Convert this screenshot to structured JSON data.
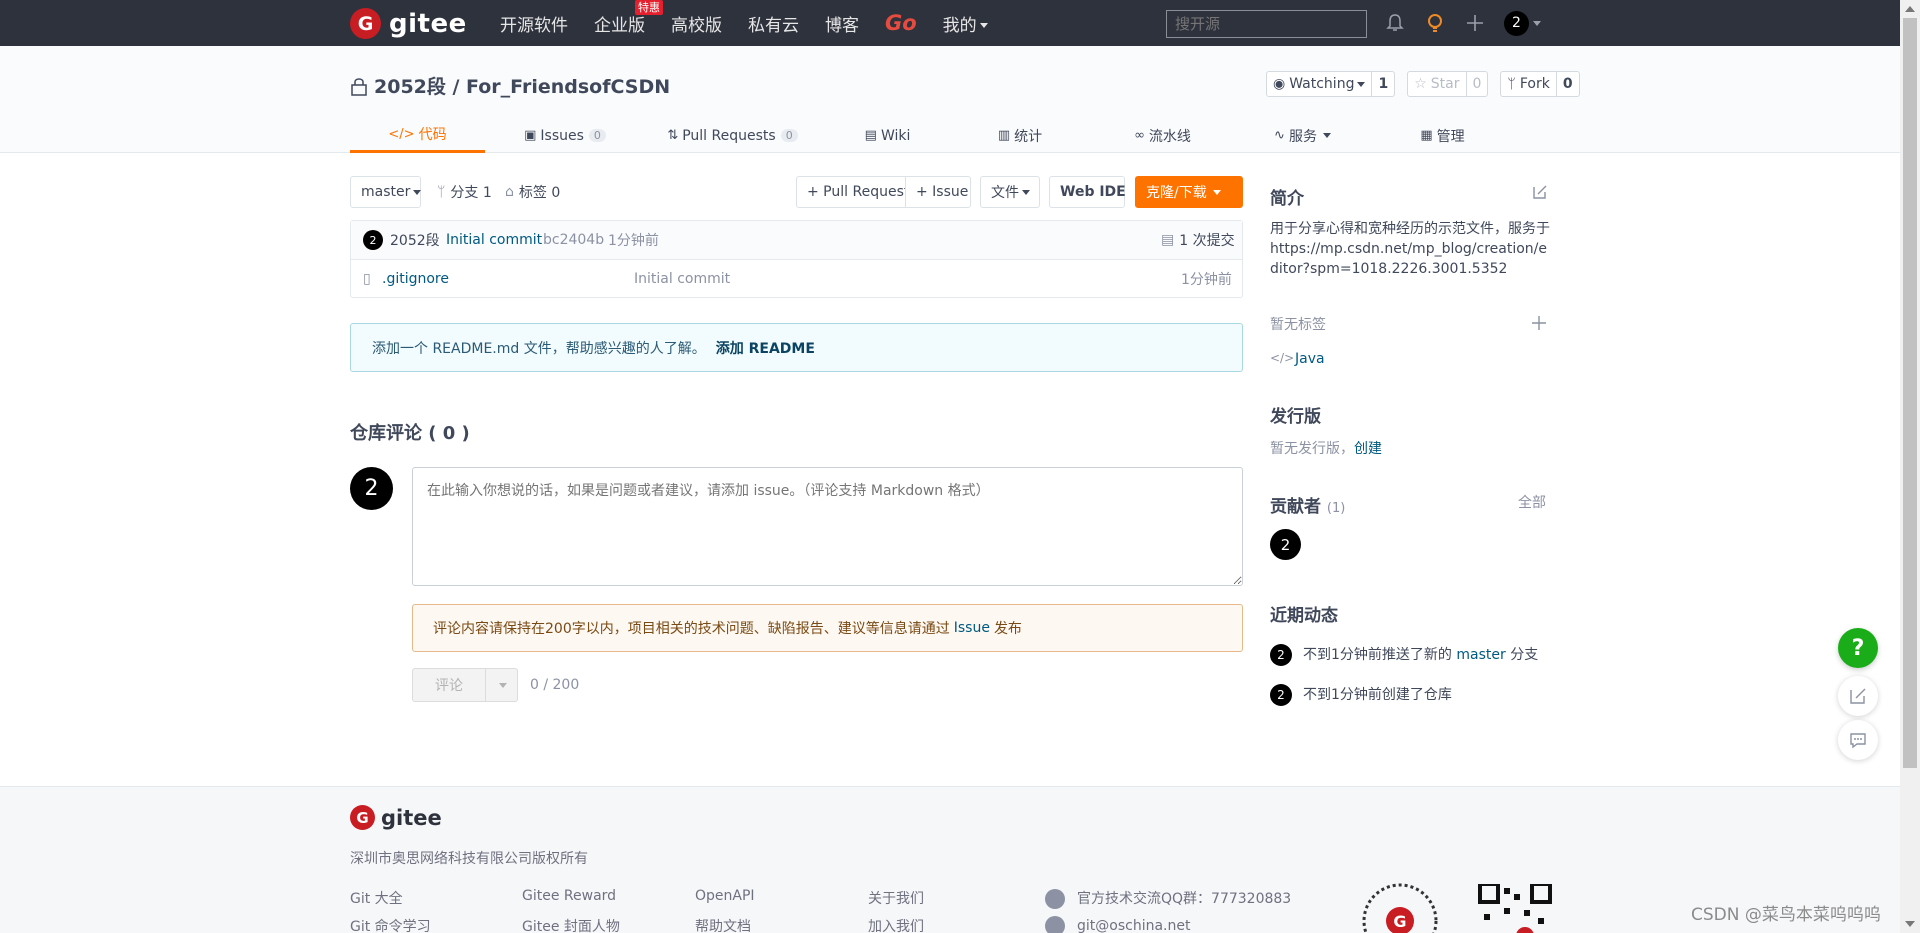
{
  "nav": {
    "logo_letter": "G",
    "logo_text": "gitee",
    "links": [
      "开源软件",
      "企业版",
      "高校版",
      "私有云",
      "博客"
    ],
    "badge": "特惠",
    "go": "Go",
    "mine": "我的",
    "search_placeholder": "搜开源",
    "avatar": "2"
  },
  "repo": {
    "title": "2052段 / For_FriendsofCSDN",
    "watch_label": "Watching",
    "watch_count": "1",
    "star_label": "Star",
    "star_count": "0",
    "fork_label": "Fork",
    "fork_count": "0"
  },
  "tabs": [
    {
      "label": "代码",
      "icon": "code-icon"
    },
    {
      "label": "Issues",
      "count": "0"
    },
    {
      "label": "Pull Requests",
      "count": "0"
    },
    {
      "label": "Wiki"
    },
    {
      "label": "统计"
    },
    {
      "label": "流水线"
    },
    {
      "label": "服务"
    },
    {
      "label": "管理"
    }
  ],
  "toolbar": {
    "branch": "master",
    "branches": "分支 1",
    "tags": "标签 0",
    "pull_request": "+ Pull Request",
    "issue": "+ Issue",
    "file": "文件",
    "web_ide": "Web IDE",
    "clone": "克隆/下载"
  },
  "commit": {
    "avatar": "2",
    "author": "2052段",
    "message": "Initial commit",
    "hash": "bc2404b",
    "time": "1分钟前",
    "commits": "1 次提交"
  },
  "files": [
    {
      "name": ".gitignore",
      "message": "Initial commit",
      "time": "1分钟前"
    }
  ],
  "readme_notice": {
    "text": "添加一个 README.md 文件，帮助感兴趣的人了解。",
    "action": "添加 README"
  },
  "comments": {
    "title": "仓库评论 ( 0 )",
    "avatar": "2",
    "placeholder": "在此输入你想说的话，如果是问题或者建议，请添加 issue。（评论支持 Markdown 格式）",
    "warning": "评论内容请保持在200字以内，项目相关的技术问题、缺陷报告、建议等信息请通过",
    "warning_link": "Issue",
    "warning_tail": "发布",
    "submit": "评论",
    "count": "0 / 200"
  },
  "sidebar": {
    "intro_title": "简介",
    "intro_text": "用于分享心得和宽种经历的示范文件，服务于",
    "intro_url": "https://mp.csdn.net/mp_blog/creation/editor?spm=1018.2226.3001.5352",
    "no_tags": "暂无标签",
    "language": "Java",
    "release_title": "发行版",
    "release_text": "暂无发行版，",
    "release_create": "创建",
    "contributors_title": "贡献者",
    "contributors_count": "(1)",
    "contributors_all": "全部",
    "contributor_avatar": "2",
    "activity_title": "近期动态",
    "activity": [
      {
        "avatar": "2",
        "pre": "不到1分钟前推送了新的",
        "link": "master",
        "post": "分支"
      },
      {
        "avatar": "2",
        "pre": "不到1分钟前创建了仓库",
        "link": "",
        "post": ""
      }
    ]
  },
  "fab": {
    "help": "?"
  },
  "footer": {
    "logo_letter": "G",
    "logo_text": "gitee",
    "copyright": "深圳市奥思网络科技有限公司版权所有",
    "col1": [
      "Git 大全",
      "Git 命令学习"
    ],
    "col2": [
      "Gitee Reward",
      "Gitee 封面人物"
    ],
    "col3": [
      "OpenAPI",
      "帮助文档"
    ],
    "col4": [
      "关于我们",
      "加入我们"
    ],
    "qq": "官方技术交流QQ群：777320883",
    "email": "git@oschina.net"
  },
  "watermark": "CSDN @菜鸟本菜呜呜呜"
}
